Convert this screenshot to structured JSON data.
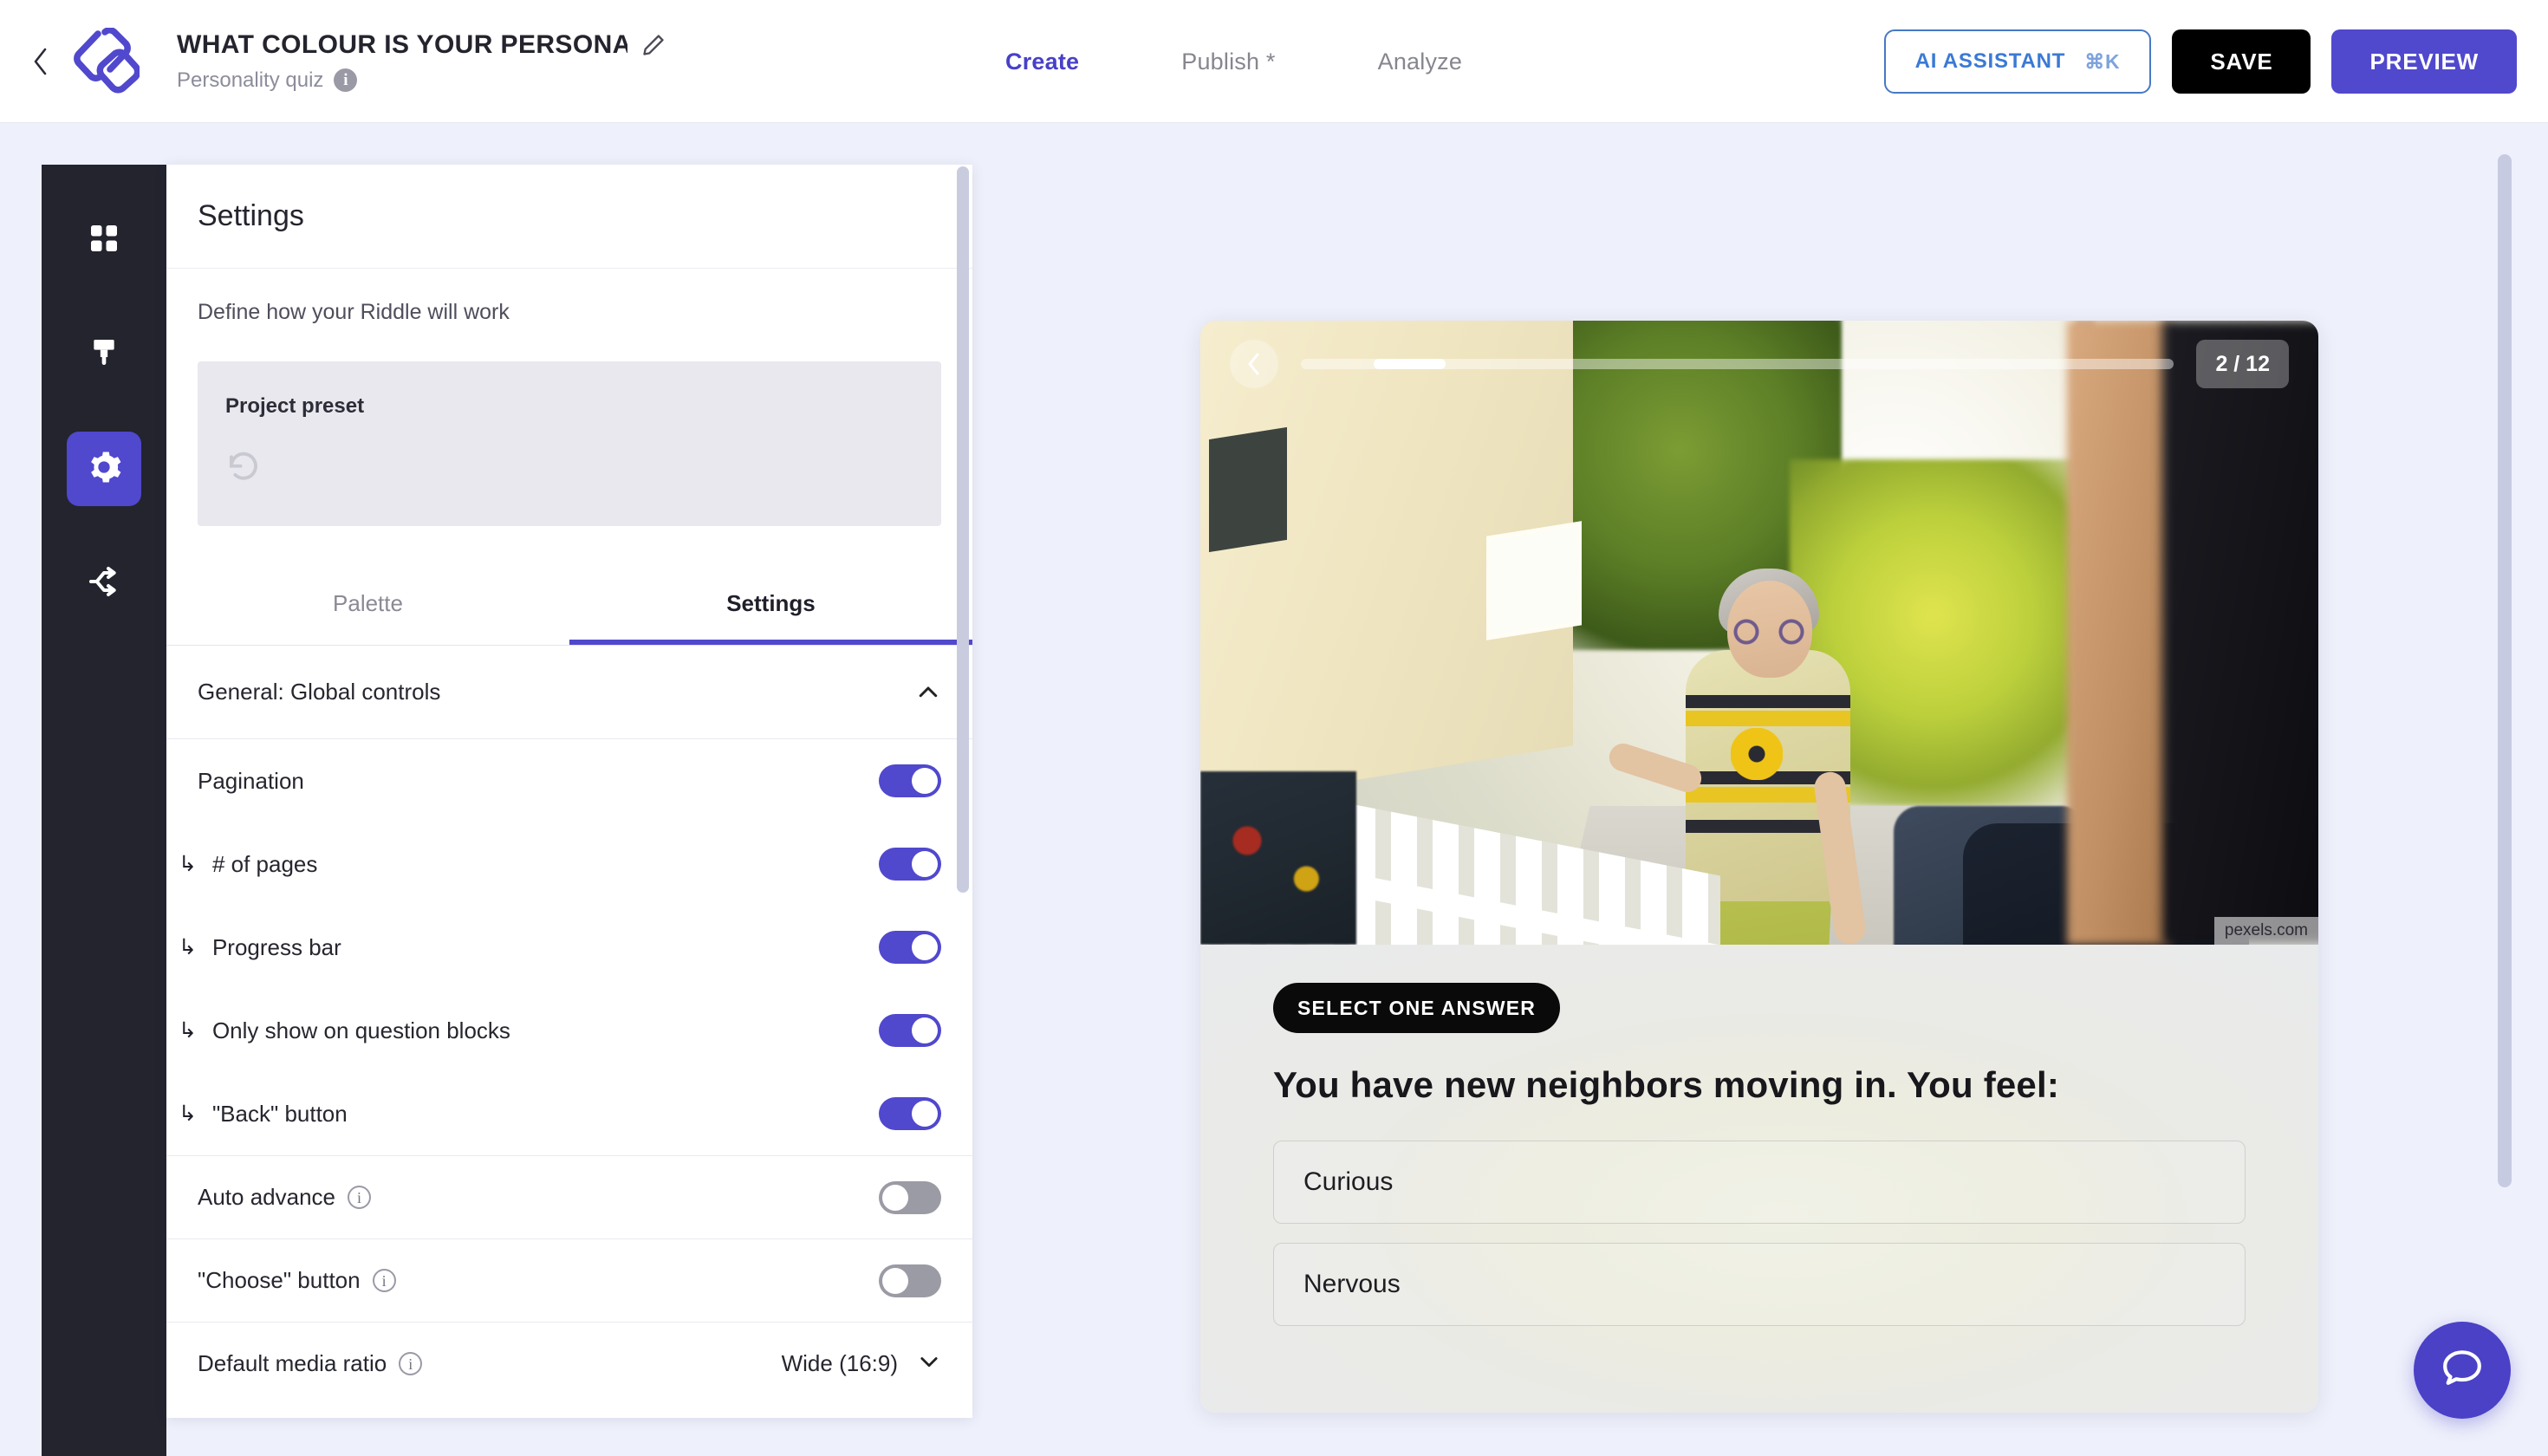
{
  "topbar": {
    "back_icon": "chevron-left-icon",
    "logo_icon": "riddle-logo-icon",
    "project_title": "WHAT COLOUR IS YOUR PERSONA…",
    "edit_icon": "pencil-icon",
    "project_type": "Personality quiz",
    "type_info_icon": "info-icon",
    "tabs": [
      {
        "label": "Create",
        "active": true
      },
      {
        "label": "Publish *",
        "active": false
      },
      {
        "label": "Analyze",
        "active": false
      }
    ],
    "ai_assistant_label": "AI ASSISTANT",
    "ai_assistant_shortcut": "⌘K",
    "save_label": "SAVE",
    "preview_label": "PREVIEW"
  },
  "rail": {
    "items": [
      {
        "name": "blocks",
        "icon": "grid-blocks-icon",
        "active": false
      },
      {
        "name": "design",
        "icon": "paint-brush-icon",
        "active": false
      },
      {
        "name": "settings",
        "icon": "gear-icon",
        "active": true
      },
      {
        "name": "share",
        "icon": "share-branch-icon",
        "active": false
      }
    ]
  },
  "panel": {
    "heading": "Settings",
    "description": "Define how your Riddle will work",
    "preset": {
      "label": "Project preset",
      "loading_icon": "spinner-icon"
    },
    "tabs": [
      {
        "label": "Palette",
        "active": false
      },
      {
        "label": "Settings",
        "active": true
      }
    ],
    "group": {
      "title": "General: Global controls",
      "collapse_icon": "chevron-up-icon",
      "expanded": true
    },
    "rows": [
      {
        "label": "Pagination",
        "indent": false,
        "toggle": "on",
        "info": false,
        "separator": false
      },
      {
        "label": "# of pages",
        "indent": true,
        "toggle": "on",
        "info": false,
        "separator": false
      },
      {
        "label": "Progress bar",
        "indent": true,
        "toggle": "on",
        "info": false,
        "separator": false
      },
      {
        "label": "Only show on question blocks",
        "indent": true,
        "toggle": "on",
        "info": false,
        "separator": false
      },
      {
        "label": "\"Back\" button",
        "indent": true,
        "toggle": "on",
        "info": false,
        "separator": false
      },
      {
        "label": "Auto advance",
        "indent": false,
        "toggle": "off",
        "info": true,
        "separator": true
      },
      {
        "label": "\"Choose\" button",
        "indent": false,
        "toggle": "off",
        "info": true,
        "separator": true
      }
    ],
    "select_row": {
      "label": "Default media ratio",
      "info": true,
      "value": "Wide (16:9)",
      "chevron_icon": "chevron-down-icon"
    }
  },
  "preview": {
    "back_icon": "chevron-left-icon",
    "page_indicator": "2 / 12",
    "progress_percent": 8.3,
    "image_credit": "pexels.com",
    "badge": "SELECT ONE ANSWER",
    "question": "You have new neighbors moving in. You feel:",
    "answers": [
      {
        "label": "Curious"
      },
      {
        "label": "Nervous"
      }
    ]
  },
  "chat": {
    "icon": "chat-bubble-icon"
  },
  "colors": {
    "accent": "#5048cd",
    "accent_tab": "#4840c8",
    "ai_border": "#4679c4",
    "ai_text": "#3b7ad4",
    "rail_bg": "#23242e",
    "page_bg": "#eef0fb",
    "toggle_off": "#9b9ba5",
    "badge_bg": "#0a0a0a"
  }
}
